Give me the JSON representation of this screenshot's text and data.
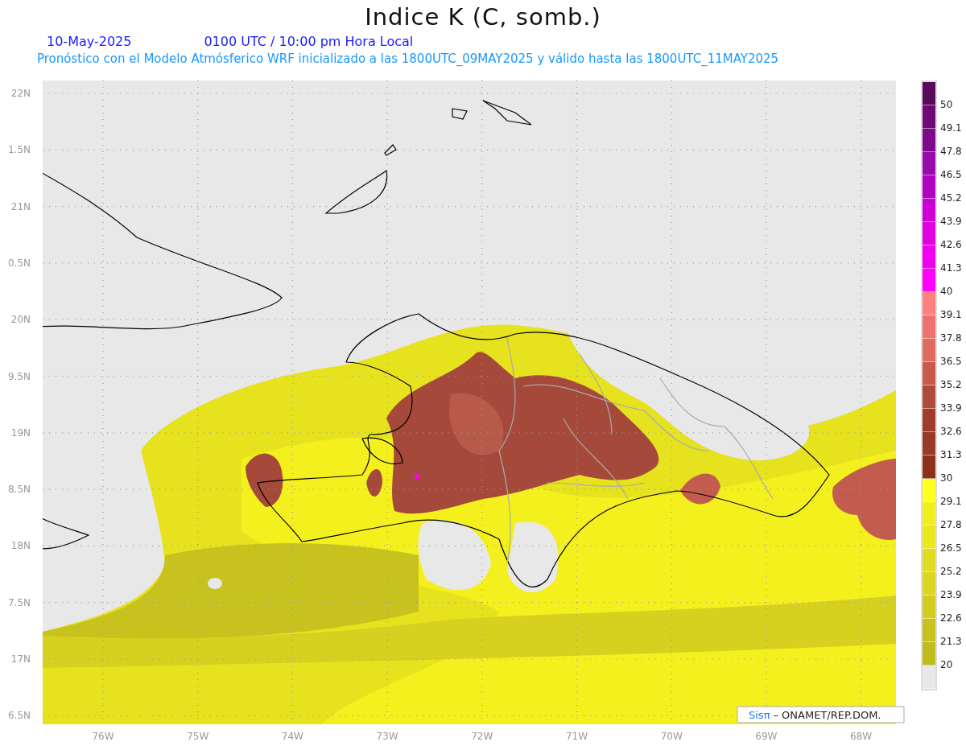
{
  "title": "Indice K (C, somb.)",
  "date": "10-May-2025",
  "time": "0100 UTC / 10:00 pm Hora Local",
  "subtitle": "Pronóstico con el Modelo Atmósferico WRF inicializado a las 1800UTC_09MAY2025 y válido hasta las  1800UTC_11MAY2025",
  "lat_labels": [
    "22N",
    "1.5N",
    "21N",
    "0.5N",
    "20N",
    "9.5N",
    "19N",
    "8.5N",
    "18N",
    "7.5N",
    "17N",
    "6.5N"
  ],
  "lon_labels": [
    "76W",
    "75W",
    "74W",
    "73W",
    "72W",
    "71W",
    "70W",
    "69W",
    "68W"
  ],
  "legend": [
    {
      "color": "#5a0a5a",
      "label": "50"
    },
    {
      "color": "#6e0a78",
      "label": "49.1"
    },
    {
      "color": "#7d0a8c",
      "label": "47.8"
    },
    {
      "color": "#9a0aaa",
      "label": "46.5"
    },
    {
      "color": "#b000c0",
      "label": "45.2"
    },
    {
      "color": "#cc00d4",
      "label": "43.9"
    },
    {
      "color": "#e000e0",
      "label": "42.6"
    },
    {
      "color": "#f000f0",
      "label": "41.3"
    },
    {
      "color": "#ff00ff",
      "label": "40"
    },
    {
      "color": "#ff8080",
      "label": "39.1"
    },
    {
      "color": "#f07070",
      "label": "37.8"
    },
    {
      "color": "#e06a60",
      "label": "36.5"
    },
    {
      "color": "#c85a4a",
      "label": "35.2"
    },
    {
      "color": "#b04a3a",
      "label": "33.9"
    },
    {
      "color": "#a03c2c",
      "label": "32.6"
    },
    {
      "color": "#983a26",
      "label": "31.3"
    },
    {
      "color": "#8b3218",
      "label": "30"
    },
    {
      "color": "#ffff20",
      "label": "29.1"
    },
    {
      "color": "#f2ee1e",
      "label": "27.8"
    },
    {
      "color": "#ece81e",
      "label": "26.5"
    },
    {
      "color": "#e2dc1e",
      "label": "25.2"
    },
    {
      "color": "#dcd61e",
      "label": "23.9"
    },
    {
      "color": "#d2cc1e",
      "label": "22.6"
    },
    {
      "color": "#c8c21e",
      "label": "21.3"
    },
    {
      "color": "#c0bc1e",
      "label": "20"
    },
    {
      "color": "#e8e8e8"
    }
  ],
  "credit": {
    "brand": "Sisπ",
    "text": "– ONAMET/REP.DOM."
  }
}
